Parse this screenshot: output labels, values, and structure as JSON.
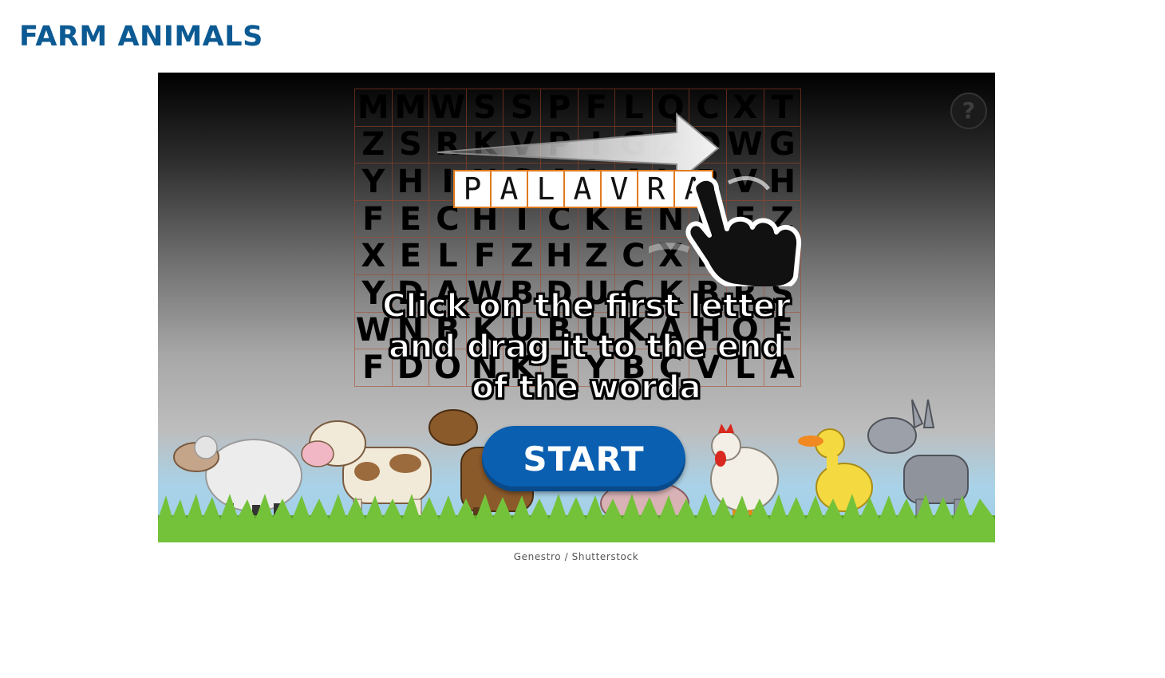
{
  "page": {
    "title": "FARM ANIMALS"
  },
  "game": {
    "help_label": "?",
    "grid_rows": [
      [
        "M",
        "M",
        "W",
        "S",
        "S",
        "P",
        "F",
        "L",
        "Q",
        "C",
        "X",
        "T"
      ],
      [
        "Z",
        "S",
        "R",
        "K",
        "V",
        "P",
        "I",
        "G",
        "Z",
        "D",
        "W",
        "G"
      ],
      [
        "Y",
        "H",
        "I",
        "N",
        "S",
        "A",
        "L",
        "A",
        "V",
        "R",
        "V",
        "H"
      ],
      [
        "F",
        "E",
        "C",
        "H",
        "I",
        "C",
        "K",
        "E",
        "N",
        "P",
        "E",
        "Z"
      ],
      [
        "X",
        "E",
        "L",
        "F",
        "Z",
        "H",
        "Z",
        "C",
        "X",
        "P",
        "T",
        "O"
      ],
      [
        "Y",
        "D",
        "A",
        "W",
        "B",
        "D",
        "U",
        "C",
        "K",
        "B",
        "R",
        "S"
      ],
      [
        "W",
        "N",
        "B",
        "K",
        "U",
        "B",
        "U",
        "K",
        "A",
        "H",
        "O",
        "E"
      ],
      [
        "F",
        "D",
        "O",
        "N",
        "K",
        "E",
        "Y",
        "B",
        "C",
        "V",
        "L",
        "A"
      ]
    ],
    "example_word": [
      "P",
      "A",
      "L",
      "A",
      "V",
      "R",
      "A"
    ],
    "instructions": "Click on the first letter and drag it to the end of the worda",
    "start_label": "START",
    "animals": [
      "sheep",
      "cow",
      "horse",
      "pig",
      "hen",
      "duck",
      "donkey"
    ]
  },
  "credit": "Genestro / Shutterstock",
  "colors": {
    "title": "#0c5a93",
    "start_button": "#0b5fb0",
    "grid_border": "#a54628",
    "word_border": "#e07a1f",
    "grass": "#5aa52a"
  }
}
